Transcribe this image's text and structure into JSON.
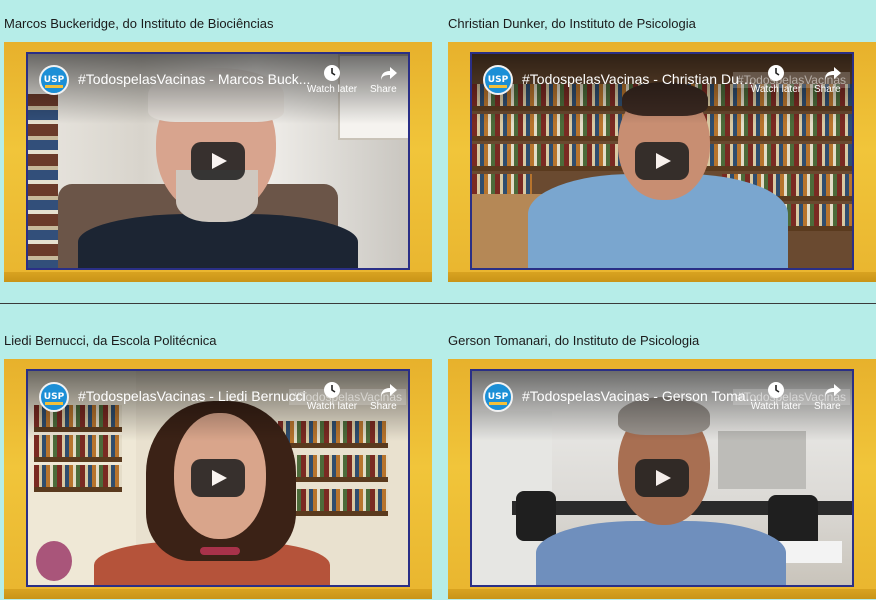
{
  "videos": [
    {
      "caption": "Marcos Buckeridge, do Instituto de Biociências",
      "title": "#TodospelasVacinas - Marcos Buck...",
      "ghost_title": "",
      "watch_later": "Watch later",
      "share": "Share",
      "logo": "USP"
    },
    {
      "caption": "Christian Dunker, do Instituto de Psicologia",
      "title": "#TodospelasVacinas - Christian Dun...",
      "ghost_title": "#TodospelasVacinas",
      "watch_later": "Watch later",
      "share": "Share",
      "logo": "USP"
    },
    {
      "caption": "Liedi Bernucci, da Escola Politécnica",
      "title": "#TodospelasVacinas - Liedi Bernucci",
      "ghost_title": "#TodospelasVacinas",
      "watch_later": "Watch later",
      "share": "Share",
      "logo": "USP"
    },
    {
      "caption": "Gerson Tomanari, do Instituto de Psicologia",
      "title": "#TodospelasVacinas - Gerson Toma...",
      "ghost_title": "#TodospelasVacinas",
      "watch_later": "Watch later",
      "share": "Share",
      "logo": "USP"
    }
  ],
  "colors": {
    "background": "#b6ede8",
    "frame_gold": "#e7b12c",
    "border_blue": "#2a2f86",
    "logo_blue": "#1c8fd6"
  },
  "icons": {
    "watch_later": "clock-icon",
    "share": "share-arrow-icon",
    "play": "play-button-icon"
  }
}
